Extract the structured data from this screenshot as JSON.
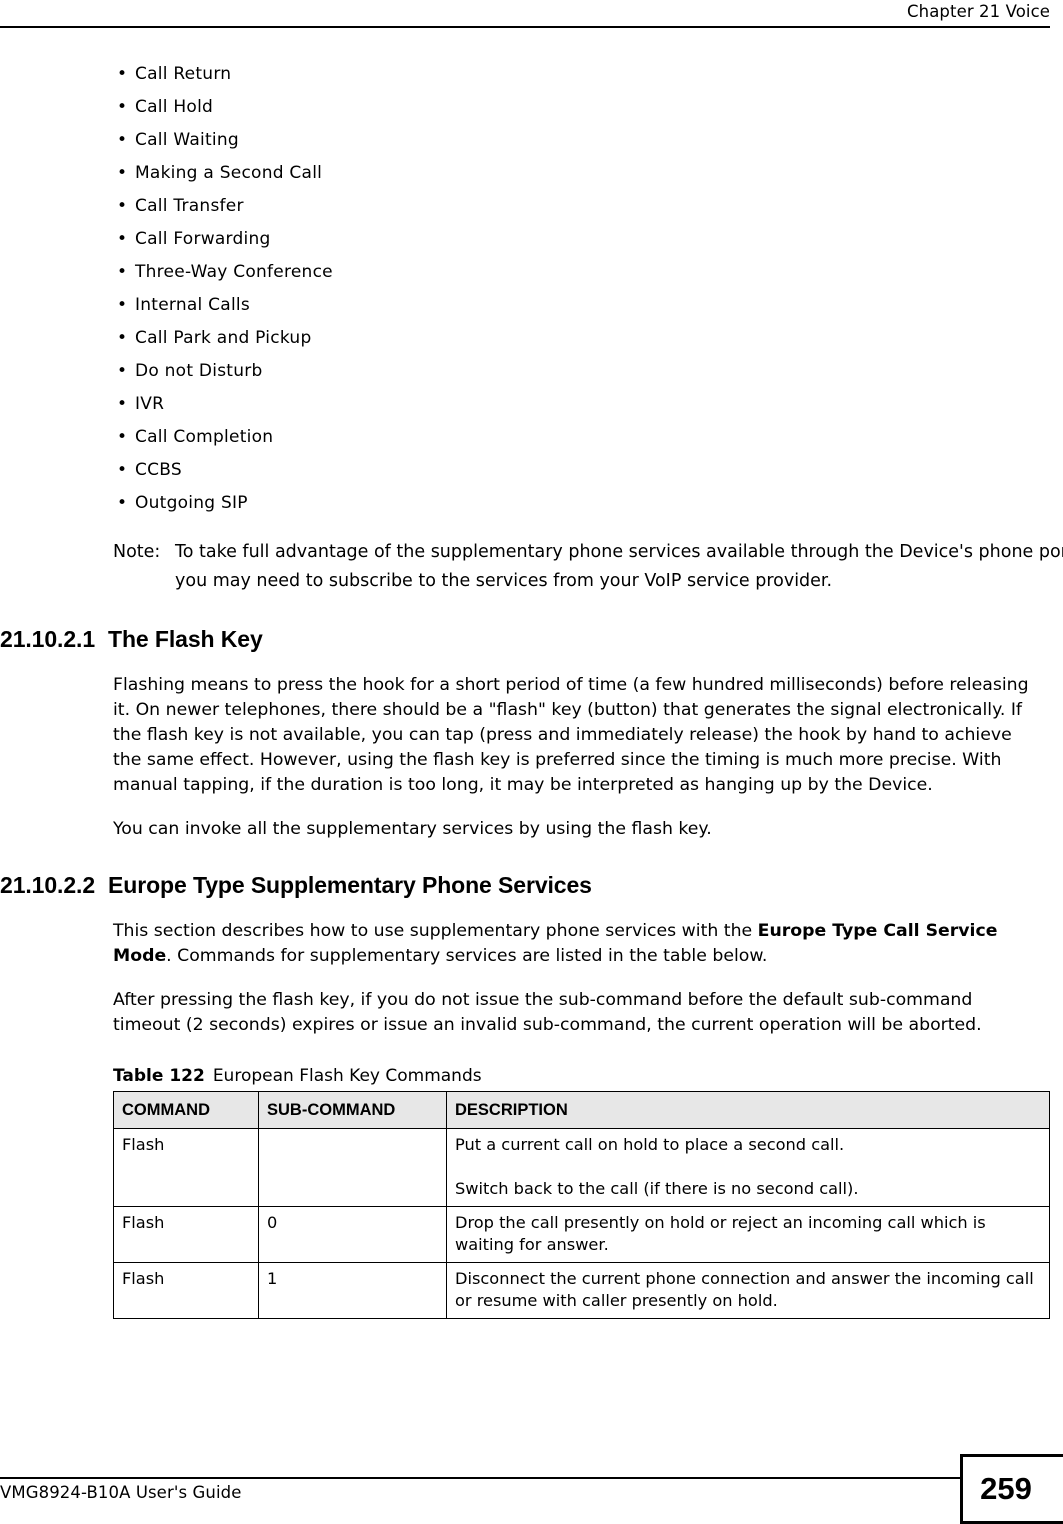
{
  "header": {
    "chapter_title": "Chapter 21 Voice"
  },
  "bullet_list": [
    "Call Return",
    "Call Hold",
    "Call Waiting",
    "Making a Second Call",
    "Call Transfer",
    "Call Forwarding",
    "Three-Way Conference",
    "Internal Calls",
    "Call Park and Pickup",
    "Do not Disturb",
    "IVR",
    "Call Completion",
    "CCBS",
    "Outgoing SIP"
  ],
  "bullet_glyph": "•",
  "note": {
    "label": "Note:",
    "text": "To take full advantage of the supplementary phone services available through the Device's phone ports, you may need to subscribe to the services from your VoIP service provider."
  },
  "sections": [
    {
      "number": "21.10.2.1",
      "title": "The Flash Key",
      "paragraphs": [
        "Flashing means to press the hook for a short period of time (a few hundred milliseconds) before releasing it. On newer telephones, there should be a \"flash\" key (button) that generates the signal electronically. If the flash key is not available, you can tap (press and immediately release) the hook by hand to achieve the same effect. However, using the flash key is preferred since the timing is much more precise. With manual tapping, if the duration is too long, it may be interpreted as hanging up by the Device.",
        "You can invoke all the supplementary services by using the flash key."
      ]
    },
    {
      "number": "21.10.2.2",
      "title": "Europe Type Supplementary Phone Services",
      "para_intro_part1": "This section describes how to use supplementary phone services with the ",
      "para_intro_bold": "Europe Type Call Service Mode",
      "para_intro_part2": ". Commands for supplementary services are listed in the table below.",
      "para_after": "After pressing the flash key, if you do not issue the sub-command before the default sub-command timeout (2 seconds) expires or issue an invalid sub-command, the current operation will be aborted."
    }
  ],
  "table": {
    "caption_label": "Table 122",
    "caption_text": "European Flash Key Commands",
    "columns": [
      "COMMAND",
      "SUB-COMMAND",
      "DESCRIPTION"
    ],
    "rows": [
      {
        "command": "Flash",
        "sub_command": "",
        "description_lines": [
          "Put a current call on hold to place a second call.",
          "Switch back to the call (if there is no second call)."
        ]
      },
      {
        "command": "Flash",
        "sub_command": "0",
        "description_lines": [
          "Drop the call presently on hold or reject an incoming call which is waiting for answer."
        ]
      },
      {
        "command": "Flash",
        "sub_command": "1",
        "description_lines": [
          "Disconnect the current phone connection and answer the incoming call or resume with caller presently on hold."
        ]
      }
    ]
  },
  "footer": {
    "guide_title": "VMG8924-B10A User's Guide",
    "page_number": "259"
  }
}
